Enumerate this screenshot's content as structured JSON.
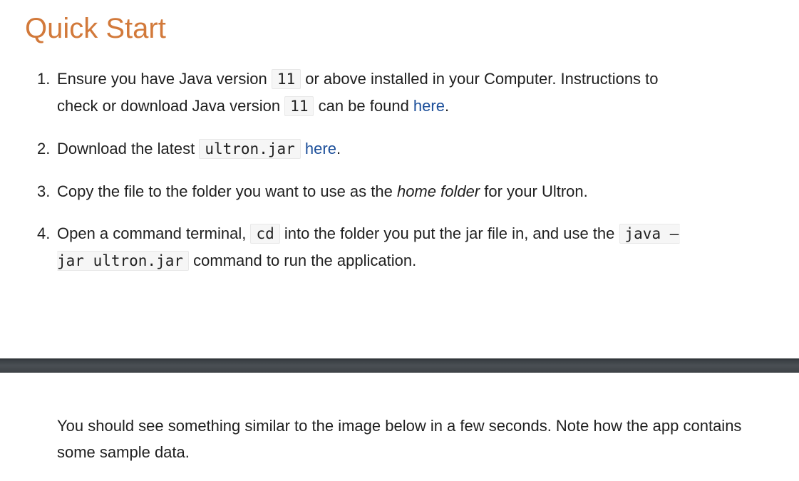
{
  "heading": "Quick Start",
  "steps": [
    {
      "number": "1.",
      "t1": "Ensure you have Java version ",
      "code1": "11",
      "t2": " or above installed in your Computer. Instructions to",
      "t3": "check or download Java version ",
      "code2": "11",
      "t4": " can be found ",
      "link": "here",
      "t5": "."
    },
    {
      "number": "2.",
      "t1": "Download the latest ",
      "code1": "ultron.jar",
      "t2": " ",
      "link": "here",
      "t3": "."
    },
    {
      "number": "3.",
      "t1": "Copy the file to the folder you want to use as the ",
      "em": "home folder",
      "t2": " for your Ultron."
    },
    {
      "number": "4.",
      "t1": "Open a command terminal, ",
      "code1": "cd",
      "t2": " into the folder you put the jar file in, and use the ",
      "code2a": "java –",
      "code2b": "jar ultron.jar",
      "t3": " command to run the application."
    }
  ],
  "note": "You should see something similar to the image below in a few seconds. Note how the app contains some sample data."
}
